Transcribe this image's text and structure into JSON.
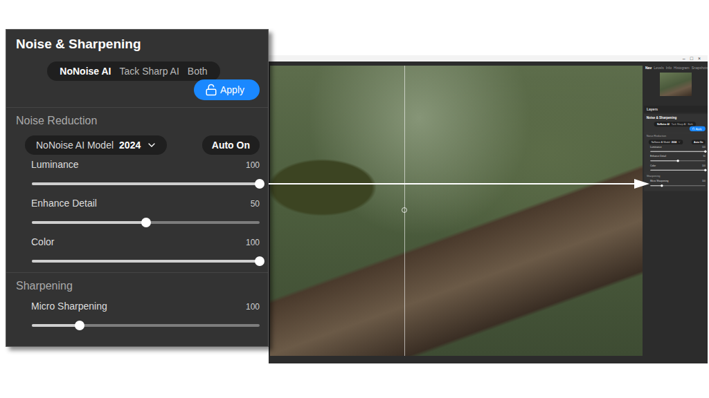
{
  "callout": {
    "title": "Noise & Sharpening",
    "modes": [
      {
        "label": "NoNoise AI",
        "selected": true
      },
      {
        "label": "Tack Sharp AI",
        "selected": false
      },
      {
        "label": "Both",
        "selected": false
      }
    ],
    "apply": {
      "label": "Apply",
      "locked": false
    },
    "noise_reduction": {
      "heading": "Noise Reduction",
      "model_label": "NoNoise AI Model",
      "model_value": "2024",
      "auto": "Auto On",
      "sliders": [
        {
          "label": "Luminance",
          "reading": "100",
          "level": 1
        },
        {
          "label": "Enhance Detail",
          "reading": "50",
          "level": 0.5
        },
        {
          "label": "Color",
          "reading": "100",
          "level": 1
        }
      ]
    },
    "sharpening": {
      "heading": "Sharpening",
      "sliders": [
        {
          "label": "Micro Sharpening",
          "reading": "100",
          "level": 0.21
        }
      ]
    }
  },
  "app": {
    "window_controls": [
      "–",
      "□",
      "×"
    ],
    "sidebar_tabs": [
      {
        "label": "Nav",
        "selected": true
      },
      {
        "label": "Levels",
        "selected": false
      },
      {
        "label": "Info",
        "selected": false
      },
      {
        "label": "Histogram",
        "selected": false
      },
      {
        "label": "Snapshots",
        "selected": false
      }
    ],
    "layers_label": "Layers",
    "photo": {
      "compare_split": 0.36
    }
  }
}
